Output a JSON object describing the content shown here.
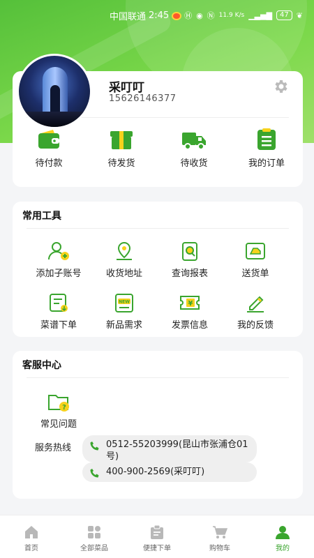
{
  "status_bar": {
    "carrier": "中国联通",
    "time": "2:45",
    "net_speed": "11.9 K/s",
    "battery": "47"
  },
  "profile": {
    "username": "采叮叮",
    "phone": "15626146377",
    "settings_icon": "gear-icon"
  },
  "orders": [
    {
      "label": "待付款",
      "icon": "wallet-icon"
    },
    {
      "label": "待发货",
      "icon": "package-icon"
    },
    {
      "label": "待收货",
      "icon": "truck-icon"
    },
    {
      "label": "我的订单",
      "icon": "order-list-icon"
    }
  ],
  "tools": {
    "title": "常用工具",
    "items": [
      {
        "label": "添加子账号",
        "icon": "add-user-icon"
      },
      {
        "label": "收货地址",
        "icon": "location-icon"
      },
      {
        "label": "查询报表",
        "icon": "report-search-icon"
      },
      {
        "label": "送货单",
        "icon": "delivery-note-icon"
      },
      {
        "label": "菜谱下单",
        "icon": "recipe-order-icon"
      },
      {
        "label": "新品需求",
        "icon": "new-product-icon"
      },
      {
        "label": "发票信息",
        "icon": "invoice-icon"
      },
      {
        "label": "我的反馈",
        "icon": "feedback-icon"
      }
    ]
  },
  "customer_service": {
    "title": "客服中心",
    "faq_label": "常见问题",
    "hotline_label": "服务热线",
    "hotlines": [
      "0512-55203999(昆山市张浦仓01号)",
      "400-900-2569(采叮叮)"
    ]
  },
  "tabbar": {
    "items": [
      {
        "label": "首页",
        "icon": "home-icon",
        "active": false
      },
      {
        "label": "全部菜品",
        "icon": "categories-icon",
        "active": false
      },
      {
        "label": "便捷下单",
        "icon": "quick-order-icon",
        "active": false
      },
      {
        "label": "购物车",
        "icon": "cart-icon",
        "active": false
      },
      {
        "label": "我的",
        "icon": "profile-icon",
        "active": true
      }
    ]
  },
  "colors": {
    "brand_green": "#4caf32",
    "accent_yellow": "#f6d21c",
    "active_tab": "#3aa52e"
  }
}
